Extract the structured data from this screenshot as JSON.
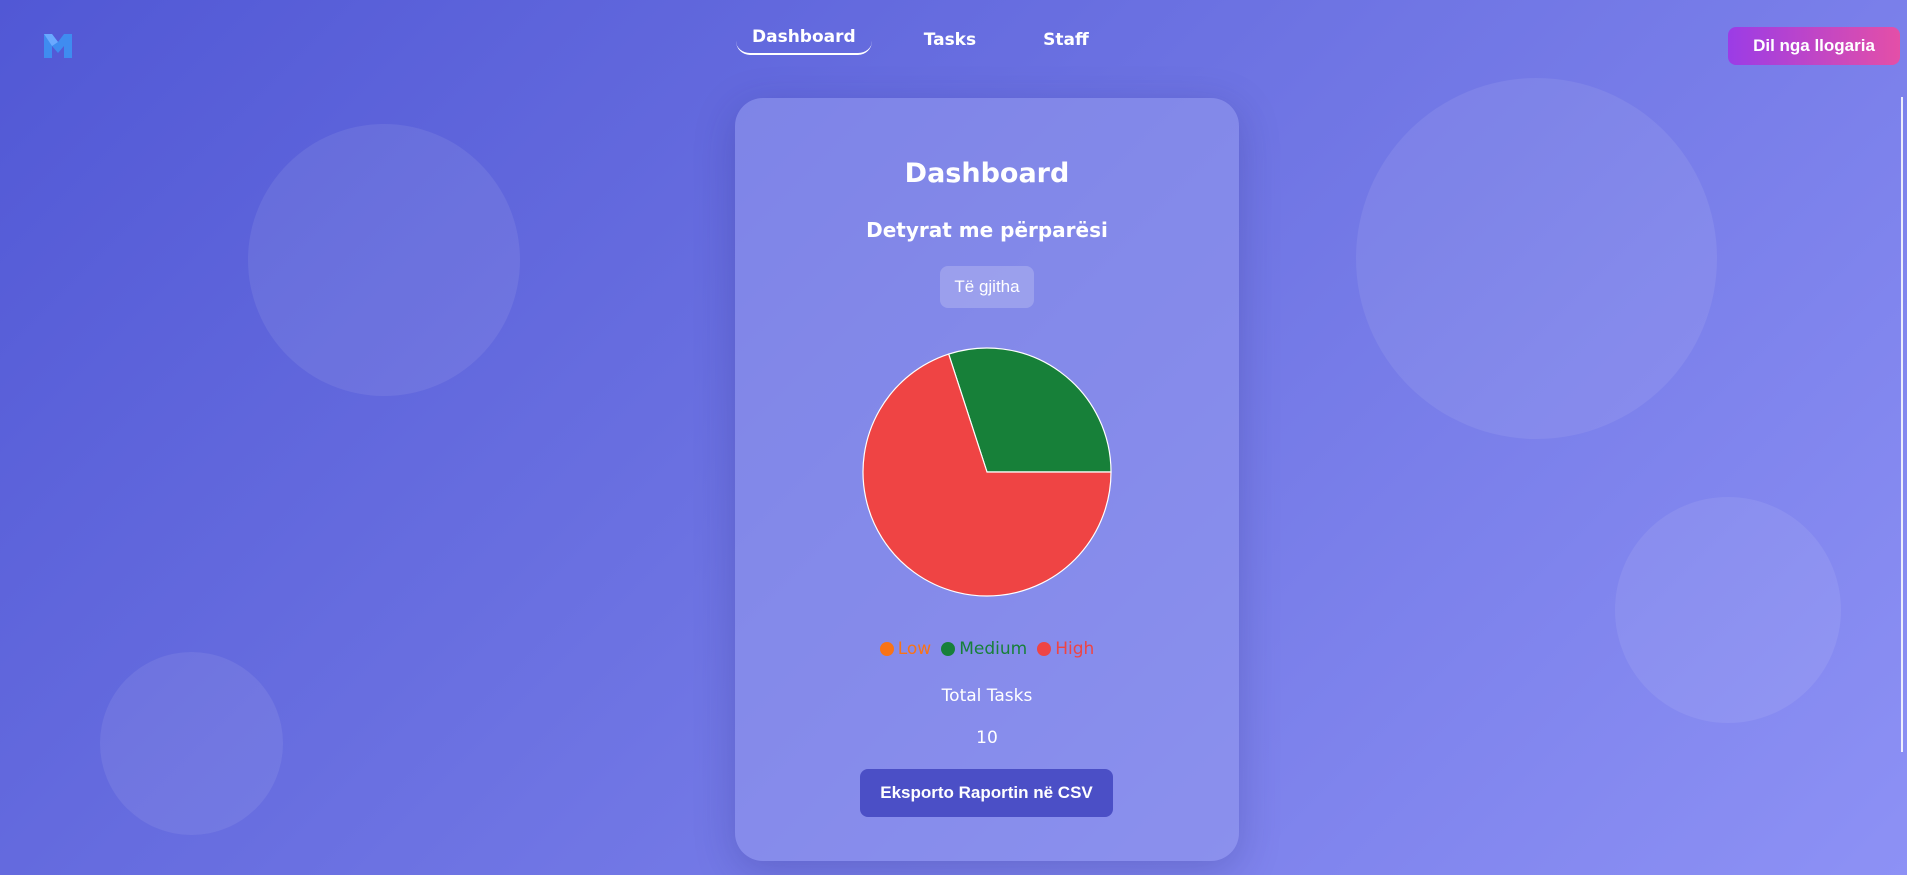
{
  "nav": {
    "logo_icon": "m-logo-icon",
    "links": [
      "Dashboard",
      "Tasks",
      "Staff"
    ],
    "active": "Dashboard",
    "logout_label": "Dil nga llogaria"
  },
  "card": {
    "title": "Dashboard",
    "subtitle": "Detyrat me përparësi",
    "filter_label": "Të gjitha",
    "total_label": "Total Tasks",
    "total_value": "10",
    "export_label": "Eksporto Raportin në CSV"
  },
  "colors": {
    "accent": "#4b4fc6",
    "logout_gradient_start": "#9b3ce6",
    "logout_gradient_end": "#e44fa7",
    "logo": "#3f8cf0"
  },
  "chart_data": {
    "type": "pie",
    "title": "",
    "categories": [
      "Low",
      "Medium",
      "High"
    ],
    "values": [
      0,
      3,
      7
    ],
    "colors": [
      "#f97316",
      "#178039",
      "#ef4444"
    ],
    "legend": "bottom"
  }
}
